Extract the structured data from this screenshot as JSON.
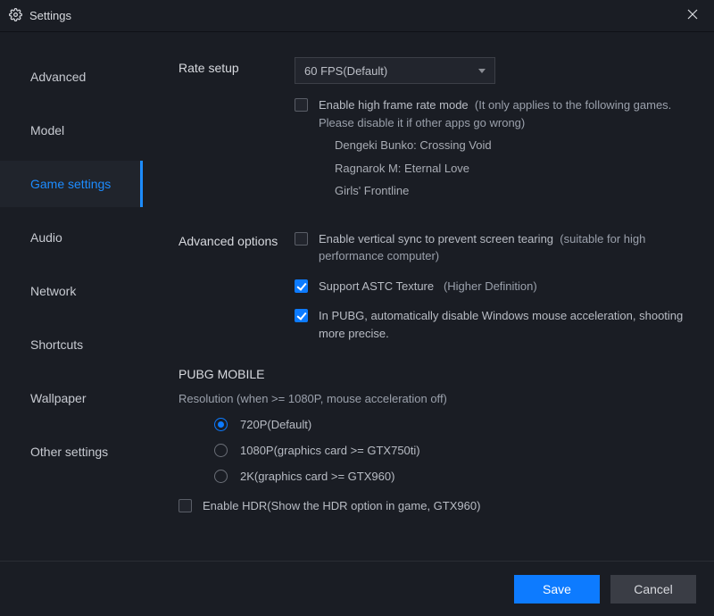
{
  "window": {
    "title": "Settings"
  },
  "sidebar": {
    "items": [
      {
        "label": "Advanced"
      },
      {
        "label": "Model"
      },
      {
        "label": "Game settings"
      },
      {
        "label": "Audio"
      },
      {
        "label": "Network"
      },
      {
        "label": "Shortcuts"
      },
      {
        "label": "Wallpaper"
      },
      {
        "label": "Other settings"
      }
    ],
    "active_index": 2
  },
  "rate_setup": {
    "label": "Rate setup",
    "select_value": "60  FPS(Default)",
    "high_frame": {
      "checked": false,
      "label": "Enable high frame rate mode",
      "hint": "(It only applies to the following games. Please disable it if other apps go wrong)",
      "games": [
        "Dengeki Bunko: Crossing Void",
        "Ragnarok M: Eternal Love",
        "Girls' Frontline"
      ]
    }
  },
  "advanced_options": {
    "label": "Advanced options",
    "vsync": {
      "checked": false,
      "label": "Enable vertical sync to prevent screen tearing",
      "hint": "(suitable for high performance computer)"
    },
    "astc": {
      "checked": true,
      "label": "Support ASTC Texture",
      "hint": "(Higher Definition)"
    },
    "pubg_mouse": {
      "checked": true,
      "label": "In PUBG, automatically disable Windows mouse acceleration, shooting more precise."
    }
  },
  "pubg": {
    "title": "PUBG MOBILE",
    "note": "Resolution (when >= 1080P, mouse acceleration off)",
    "resolutions": [
      {
        "label": "720P(Default)",
        "selected": true
      },
      {
        "label": "1080P(graphics card >= GTX750ti)",
        "selected": false
      },
      {
        "label": "2K(graphics card >= GTX960)",
        "selected": false
      }
    ],
    "hdr": {
      "checked": false,
      "label": "Enable HDR(Show the HDR option in game, GTX960)"
    }
  },
  "footer": {
    "save": "Save",
    "cancel": "Cancel"
  }
}
